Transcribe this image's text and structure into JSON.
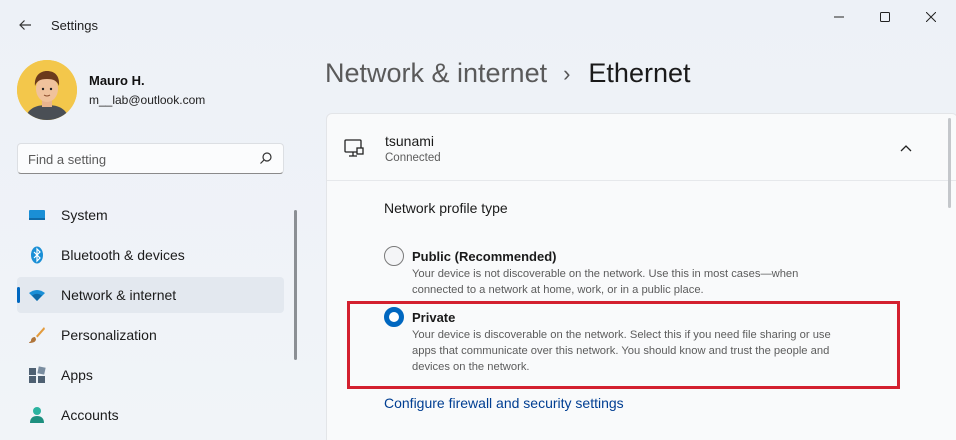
{
  "window": {
    "title": "Settings",
    "controls": [
      "minimize",
      "maximize",
      "close"
    ]
  },
  "user": {
    "name": "Mauro H.",
    "email": "m__lab@outlook.com"
  },
  "search": {
    "placeholder": "Find a setting"
  },
  "sidebar": {
    "items": [
      {
        "label": "System",
        "icon": "monitor-icon",
        "active": false
      },
      {
        "label": "Bluetooth & devices",
        "icon": "bluetooth-icon",
        "active": false
      },
      {
        "label": "Network & internet",
        "icon": "wifi-icon",
        "active": true
      },
      {
        "label": "Personalization",
        "icon": "brush-icon",
        "active": false
      },
      {
        "label": "Apps",
        "icon": "apps-icon",
        "active": false
      },
      {
        "label": "Accounts",
        "icon": "person-icon",
        "active": false
      }
    ]
  },
  "breadcrumb": {
    "parent": "Network & internet",
    "separator": "›",
    "current": "Ethernet"
  },
  "network": {
    "name": "tsunami",
    "status": "Connected",
    "profile_label": "Network profile type",
    "options": [
      {
        "title": "Public (Recommended)",
        "desc_lines": [
          "Your device is not discoverable on the network. Use this in most cases—when",
          "connected to a network at home, work, or in a public place."
        ],
        "selected": false
      },
      {
        "title": "Private",
        "desc_lines": [
          "Your device is discoverable on the network. Select this if you need file sharing or use",
          "apps that communicate over this network. You should know and trust the people and",
          "devices on the network."
        ],
        "selected": true
      }
    ],
    "firewall_link": "Configure firewall and security settings"
  },
  "colors": {
    "accent": "#0067c0",
    "highlight": "#d3202f",
    "link": "#003e92"
  }
}
